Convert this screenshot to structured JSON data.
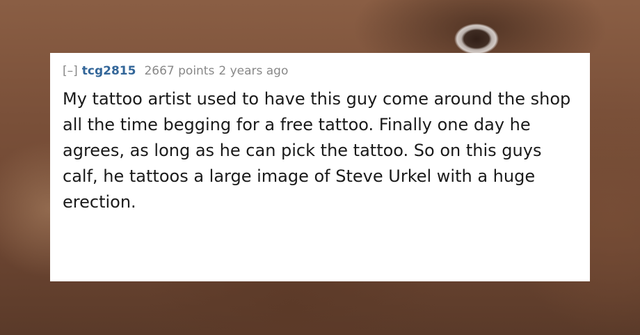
{
  "comment": {
    "collapse_label": "[–]",
    "author": "tcg2815",
    "points": "2667 points",
    "time": "2 years ago",
    "body": "My tattoo artist used to have this guy come around the shop all the time begging for a free tattoo. Finally one day he agrees, as long as he can pick the tattoo. So on this guys calf, he tattoos a large image of Steve Urkel with a huge erection."
  },
  "colors": {
    "author_link": "#336699",
    "meta_gray": "#888888",
    "card_background": "#ffffff"
  }
}
